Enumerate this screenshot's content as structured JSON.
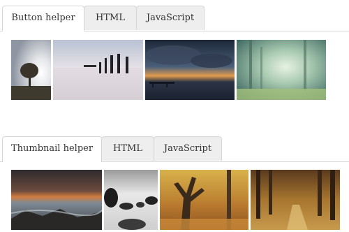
{
  "button_helper_section": {
    "tabs": [
      {
        "label": "Button helper",
        "active": true
      },
      {
        "label": "HTML",
        "active": false
      },
      {
        "label": "JavaScript",
        "active": false
      }
    ],
    "images": [
      {
        "name": "lone-tree-sunrise-image"
      },
      {
        "name": "pier-posts-seascape-image"
      },
      {
        "name": "pier-sunset-clouds-image"
      },
      {
        "name": "misty-forest-image"
      }
    ]
  },
  "thumbnail_helper_section": {
    "tabs": [
      {
        "label": "Thumbnail helper",
        "active": true
      },
      {
        "label": "HTML",
        "active": false
      },
      {
        "label": "JavaScript",
        "active": false
      }
    ],
    "images": [
      {
        "name": "rocky-coast-sunset-image"
      },
      {
        "name": "black-white-rocks-image"
      },
      {
        "name": "autumn-tree-image"
      },
      {
        "name": "autumn-forest-path-image"
      }
    ]
  }
}
